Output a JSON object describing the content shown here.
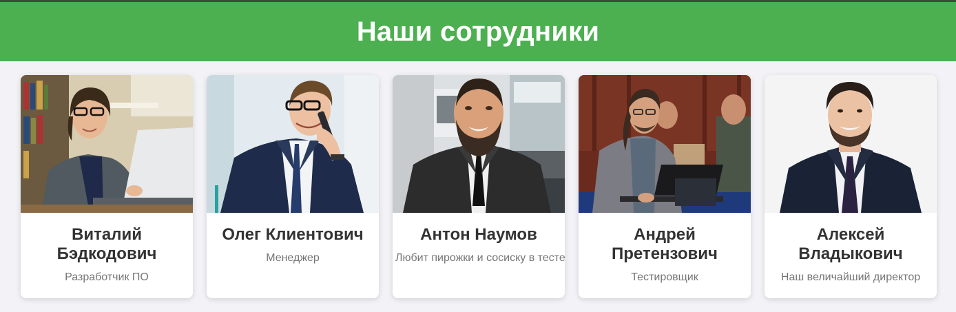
{
  "header": {
    "title": "Наши сотрудники"
  },
  "colors": {
    "header_bg": "#4caf50",
    "page_bg": "#f3f3f7",
    "name_text": "#333333",
    "role_text": "#757575"
  },
  "employees": [
    {
      "name": "Виталий Бэдкодович",
      "role": "Разработчик ПО",
      "photo_icon": "developer-with-laptop-photo"
    },
    {
      "name": "Олег Клиентович",
      "role": "Менеджер",
      "photo_icon": "manager-on-phone-photo"
    },
    {
      "name": "Антон Наумов",
      "role": "Любит пирожки и сосиску в тесте",
      "photo_icon": "bearded-man-in-suit-photo"
    },
    {
      "name": "Андрей Претензович",
      "role": "Тестировщик",
      "photo_icon": "tester-at-laptop-photo"
    },
    {
      "name": "Алексей Владыкович",
      "role": "Наш величайший директор",
      "photo_icon": "director-portrait-photo"
    }
  ]
}
